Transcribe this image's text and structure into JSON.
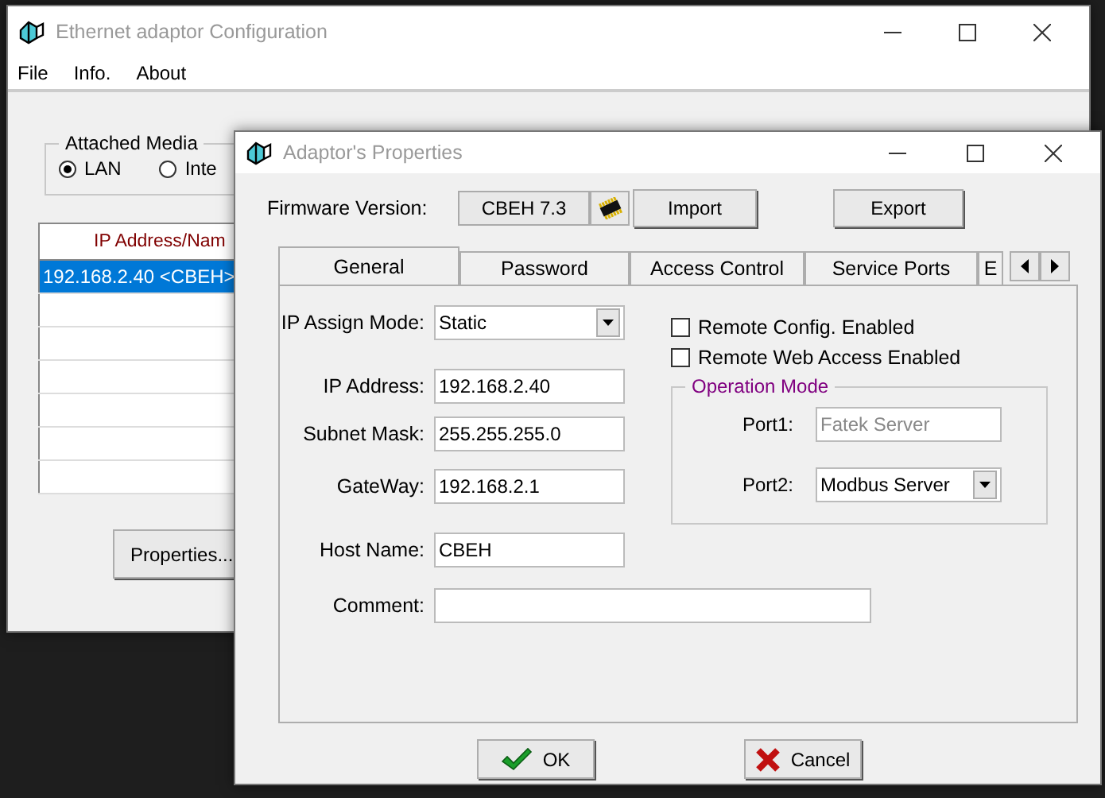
{
  "main_window": {
    "title": "Ethernet adaptor Configuration",
    "menu": [
      "File",
      "Info.",
      "About"
    ],
    "attached_media": {
      "label": "Attached Media",
      "options": [
        {
          "label": "LAN",
          "selected": true
        },
        {
          "label": "Inte",
          "selected": false
        }
      ]
    },
    "table": {
      "columns": [
        "IP Address/Nam"
      ],
      "rows": [
        {
          "cells": [
            "192.168.2.40 <CBEH>"
          ],
          "selected": true
        }
      ]
    },
    "properties_button": "Properties..."
  },
  "dialog": {
    "title": "Adaptor's Properties",
    "firmware": {
      "label": "Firmware Version:",
      "value": "CBEH 7.3"
    },
    "import_button": "Import",
    "export_button": "Export",
    "tabs": [
      {
        "label": "General",
        "selected": true
      },
      {
        "label": "Password",
        "selected": false
      },
      {
        "label": "Access Control",
        "selected": false
      },
      {
        "label": "Service Ports",
        "selected": false
      },
      {
        "label": "E",
        "selected": false
      }
    ],
    "fields": [
      {
        "label": "IP Assign Mode:",
        "kind": "select",
        "value": "Static"
      },
      {
        "label": "IP Address:",
        "kind": "input",
        "value": "192.168.2.40"
      },
      {
        "label": "Subnet Mask:",
        "kind": "input",
        "value": "255.255.255.0"
      },
      {
        "label": "GateWay:",
        "kind": "input",
        "value": "192.168.2.1"
      },
      {
        "label": "Host Name:",
        "kind": "input",
        "value": "CBEH"
      }
    ],
    "comment": {
      "label": "Comment:"
    },
    "checkboxes": [
      {
        "label": "Remote Config. Enabled",
        "checked": false
      },
      {
        "label": "Remote Web Access Enabled",
        "checked": false
      }
    ],
    "operation_mode": {
      "title": "Operation Mode",
      "ports": [
        {
          "label": "Port1:",
          "kind": "input",
          "value": "Fatek Server",
          "disabled": true
        },
        {
          "label": "Port2:",
          "kind": "select",
          "value": "Modbus Server",
          "disabled": false
        }
      ]
    },
    "ok_button": "OK",
    "cancel_button": "Cancel"
  }
}
